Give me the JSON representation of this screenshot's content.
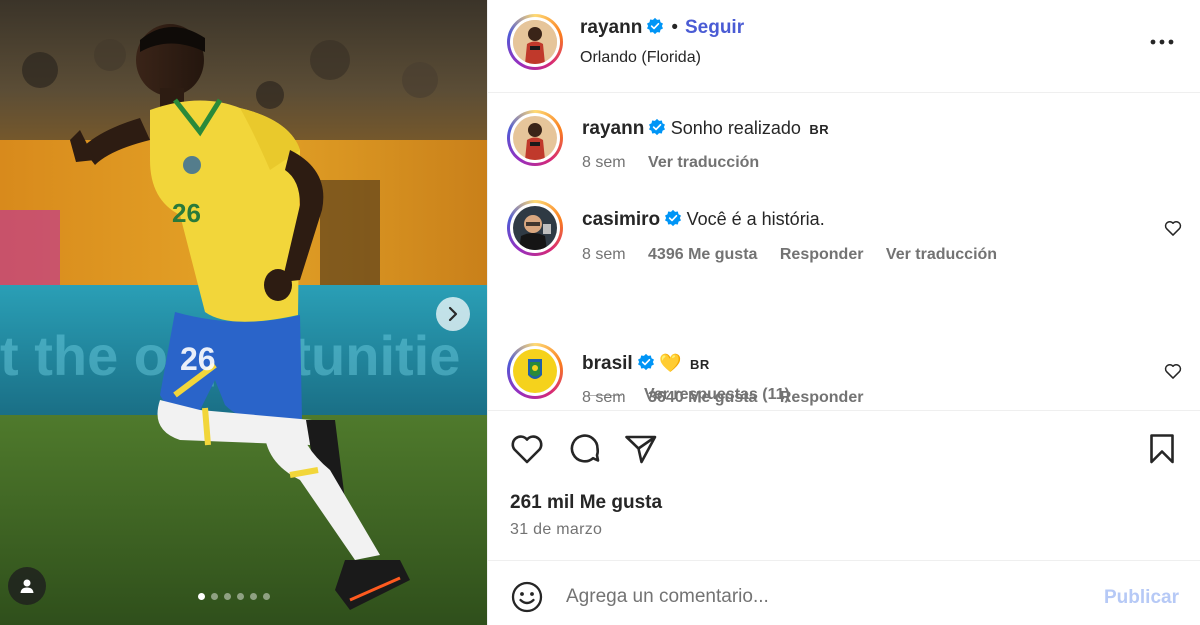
{
  "post": {
    "author": "rayann",
    "follow_label": "Seguir",
    "separator": "•",
    "location": "Orlando (Florida)",
    "more_icon": "more-horizontal-icon"
  },
  "media": {
    "slide_count": 6,
    "active_slide": 1,
    "next_icon": "chevron-right-icon",
    "user_tag_icon": "person-icon",
    "jersey_number": "26"
  },
  "comments": [
    {
      "username": "rayann",
      "text": "Sonho realizado",
      "flag": "BR",
      "time": "8 sem",
      "translate": "Ver traducción"
    },
    {
      "username": "casimiro",
      "text": "Você é a história.",
      "time": "8 sem",
      "likes": "4396 Me gusta",
      "reply": "Responder",
      "translate": "Ver traducción",
      "view_replies": "Ver respuestas (11)"
    },
    {
      "username": "brasil",
      "emoji": "💛",
      "flag": "BR",
      "time": "8 sem",
      "likes": "3640 Me gusta",
      "reply": "Responder"
    }
  ],
  "actions": {
    "like_icon": "heart-icon",
    "comment_icon": "comment-icon",
    "share_icon": "send-icon",
    "save_icon": "bookmark-icon",
    "likes_text": "261 mil Me gusta",
    "date": "31 de marzo"
  },
  "composer": {
    "emoji_icon": "emoji-icon",
    "placeholder": "Agrega un comentario...",
    "publish_label": "Publicar"
  },
  "colors": {
    "accent": "#4a5bd4",
    "verified": "#0095f6",
    "publish_disabled": "#b6c9f6",
    "muted": "#737373"
  }
}
